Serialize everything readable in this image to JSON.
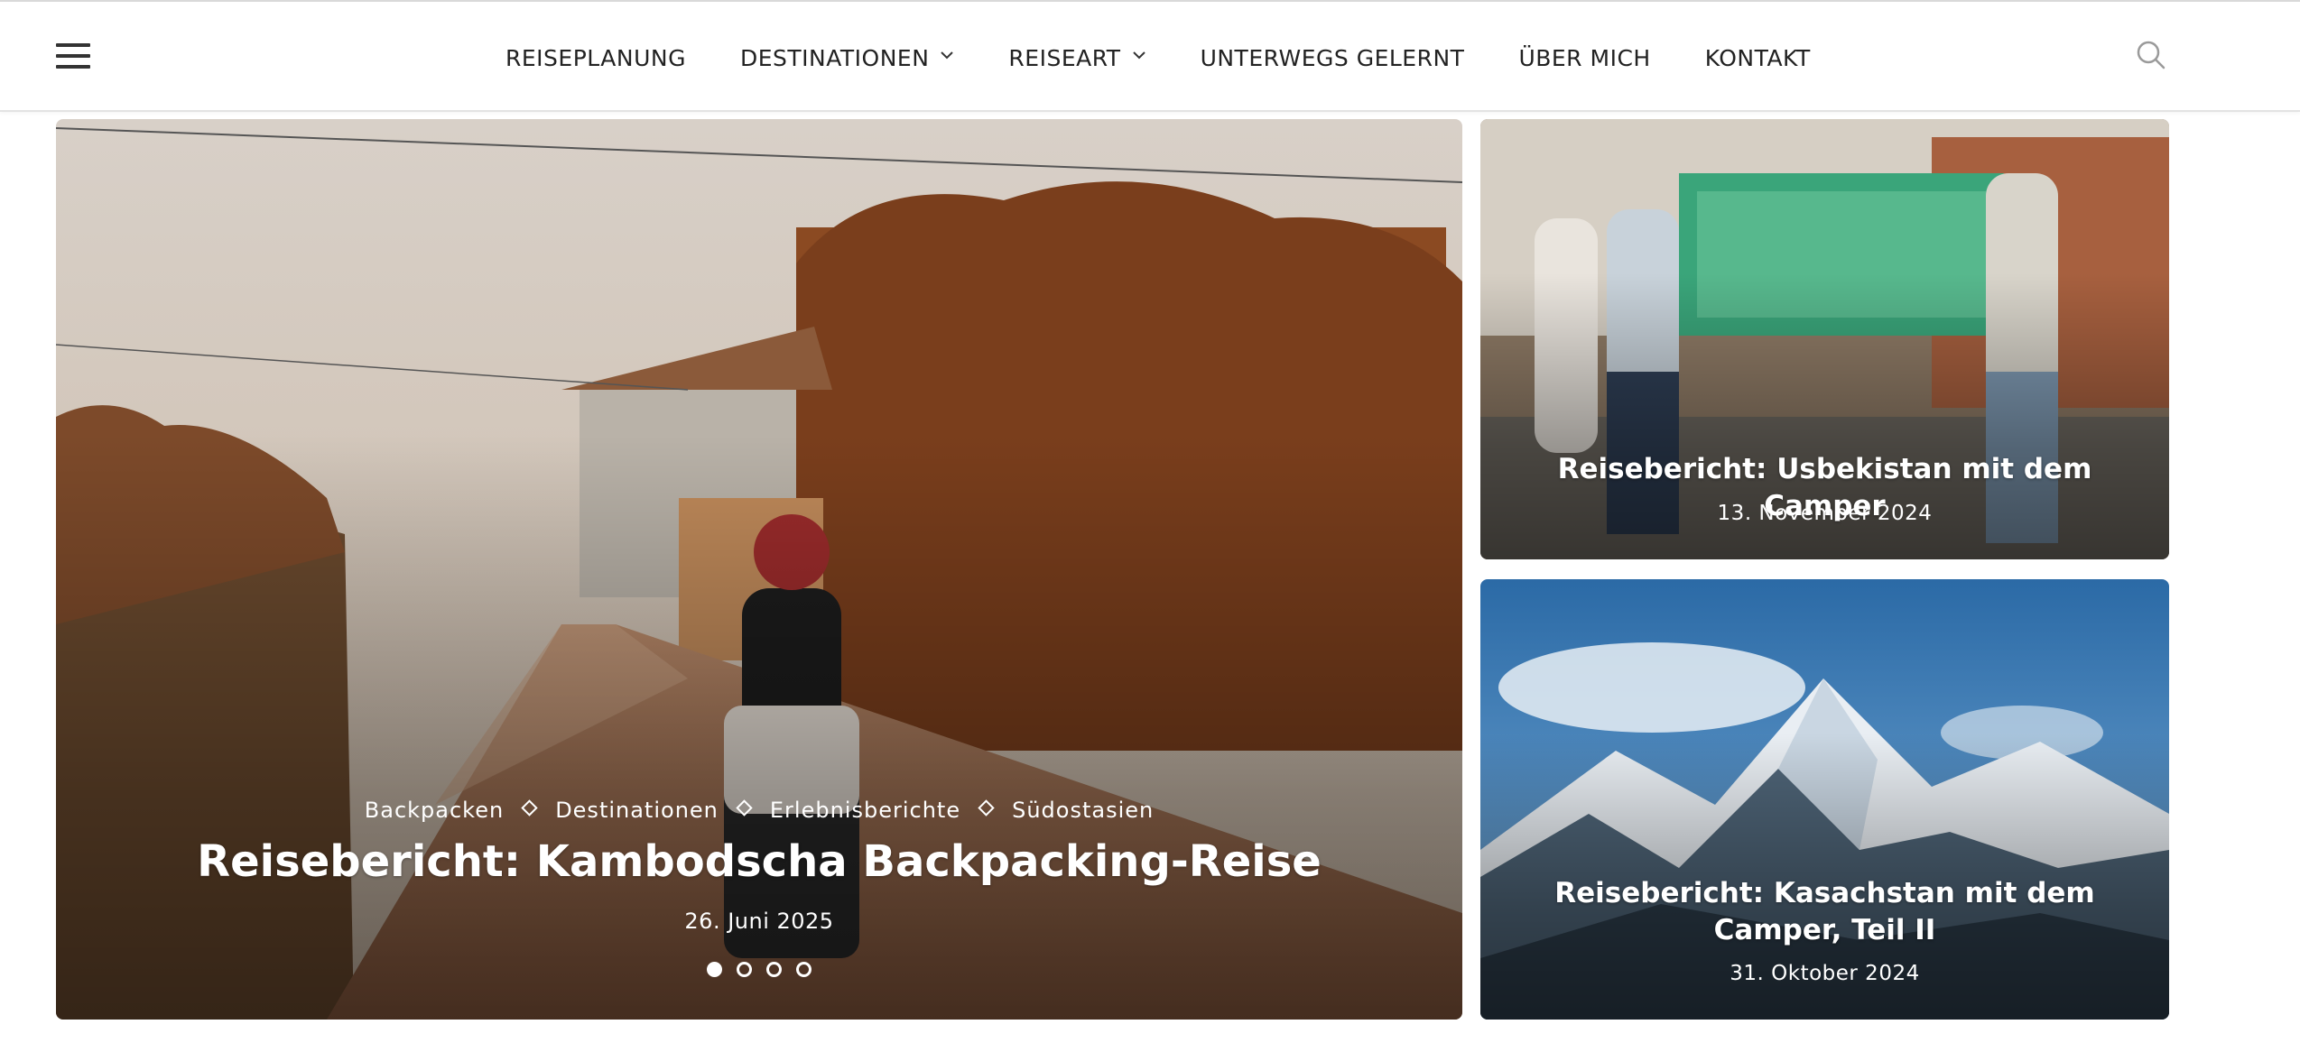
{
  "header": {
    "menu_icon": "hamburger-menu-icon",
    "nav": [
      {
        "label": "REISEPLANUNG",
        "has_dropdown": false
      },
      {
        "label": "DESTINATIONEN",
        "has_dropdown": true
      },
      {
        "label": "REISEART",
        "has_dropdown": true
      },
      {
        "label": "UNTERWEGS GELERNT",
        "has_dropdown": false
      },
      {
        "label": "ÜBER MICH",
        "has_dropdown": false
      },
      {
        "label": "KONTAKT",
        "has_dropdown": false
      }
    ],
    "search_icon": "search-icon"
  },
  "hero": {
    "categories": [
      "Backpacken",
      "Destinationen",
      "Erlebnisberichte",
      "Südostasien"
    ],
    "title": "Reisebericht: Kambodscha Backpacking-Reise",
    "date": "26. Juni 2025",
    "slides_total": 4,
    "active_slide": 1
  },
  "side_posts": [
    {
      "title": "Reisebericht: Usbekistan mit dem Camper",
      "date": "13. November 2024"
    },
    {
      "title": "Reisebericht: Kasachstan mit dem Camper, Teil II",
      "date": "31. Oktober 2024"
    }
  ],
  "colors": {
    "text": "#222222",
    "overlay_text": "#ffffff",
    "header_border": "#e3e3e3"
  }
}
